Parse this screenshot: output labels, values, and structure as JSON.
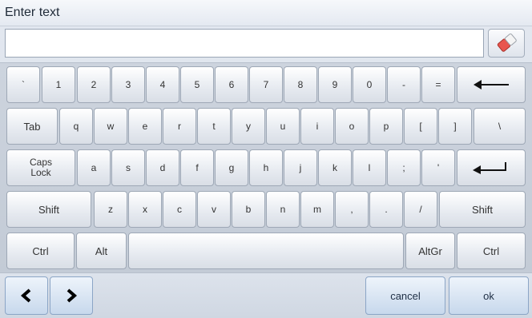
{
  "window": {
    "title": "Enter text"
  },
  "input": {
    "value": ""
  },
  "clear_button": {
    "icon": "eraser-icon"
  },
  "keyboard": {
    "row1": [
      "`",
      "1",
      "2",
      "3",
      "4",
      "5",
      "6",
      "7",
      "8",
      "9",
      "0",
      "-",
      "="
    ],
    "row1_backspace_icon": "backspace-arrow-icon",
    "row2_tab": "Tab",
    "row2": [
      "q",
      "w",
      "e",
      "r",
      "t",
      "y",
      "u",
      "i",
      "o",
      "p",
      "[",
      "]",
      "\\"
    ],
    "row3_caps": [
      "Caps",
      "Lock"
    ],
    "row3": [
      "a",
      "s",
      "d",
      "f",
      "g",
      "h",
      "j",
      "k",
      "l",
      ";",
      "'"
    ],
    "row3_enter_icon": "enter-arrow-icon",
    "row4_shift_left": "Shift",
    "row4": [
      "z",
      "x",
      "c",
      "v",
      "b",
      "n",
      "m",
      ",",
      ".",
      "/"
    ],
    "row4_shift_right": "Shift",
    "row5": {
      "ctrl_left": "Ctrl",
      "alt": "Alt",
      "space": "",
      "altgr": "AltGr",
      "ctrl_right": "Ctrl"
    }
  },
  "footer": {
    "prev_icon": "chevron-left-icon",
    "next_icon": "chevron-right-icon",
    "cancel_label": "cancel",
    "ok_label": "ok"
  }
}
